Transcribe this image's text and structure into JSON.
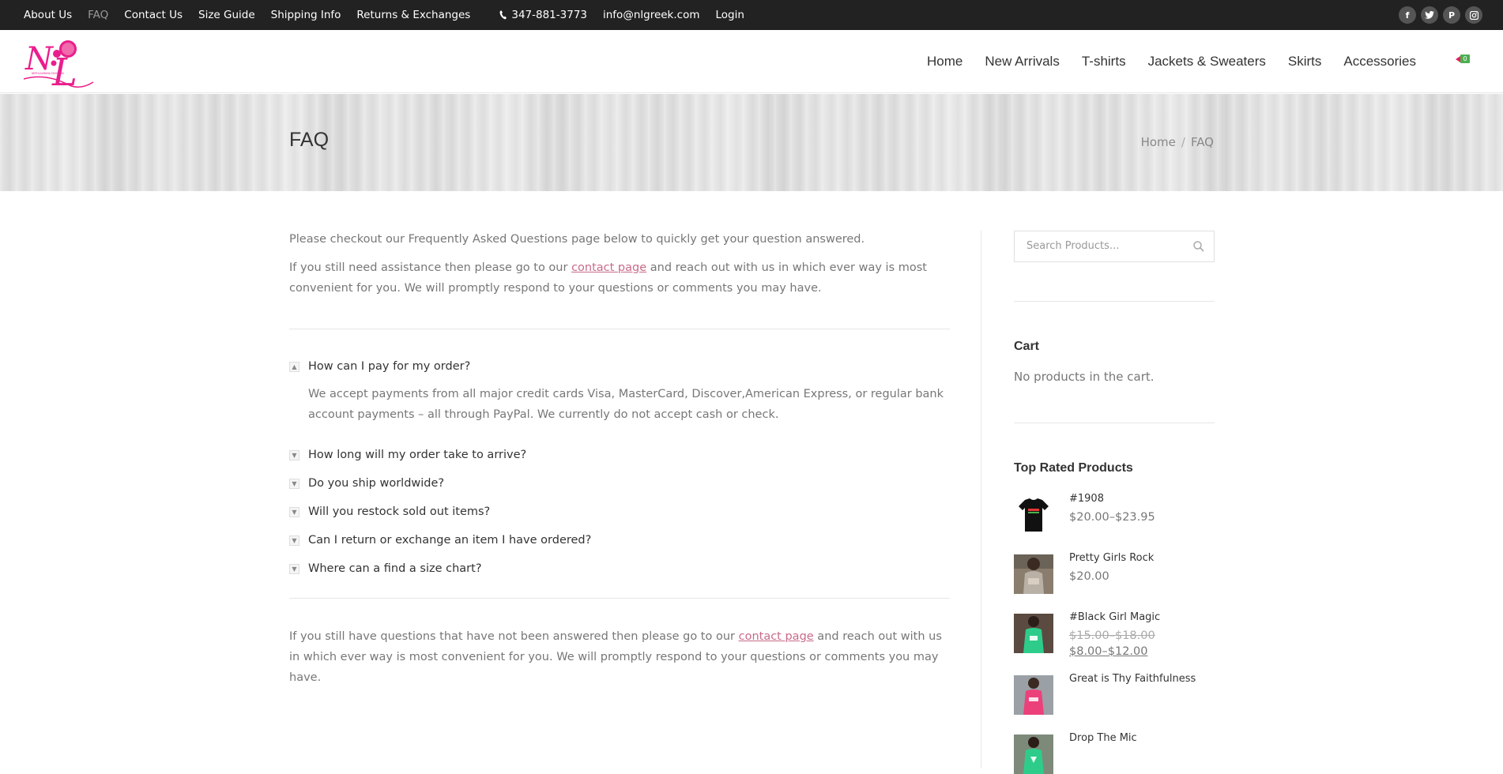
{
  "topbar": {
    "links": [
      {
        "label": "About Us",
        "active": false
      },
      {
        "label": "FAQ",
        "active": true
      },
      {
        "label": "Contact Us",
        "active": false
      },
      {
        "label": "Size Guide",
        "active": false
      },
      {
        "label": "Shipping Info",
        "active": false
      },
      {
        "label": "Returns & Exchanges",
        "active": false
      }
    ],
    "phone": "347-881-3773",
    "email": "info@nlgreek.com",
    "login": "Login",
    "social": [
      "facebook-icon",
      "twitter-icon",
      "pinterest-icon",
      "instagram-icon"
    ]
  },
  "header": {
    "logo_text": "NEPHLAURANA FASHIONS",
    "nav": [
      "Home",
      "New Arrivals",
      "T-shirts",
      "Jackets & Sweaters",
      "Skirts",
      "Accessories"
    ],
    "cart_count": "0"
  },
  "titlebar": {
    "title": "FAQ",
    "breadcrumb_home": "Home",
    "breadcrumb_sep": "/",
    "breadcrumb_current": "FAQ"
  },
  "content": {
    "intro_1": "Please checkout our Frequently Asked Questions page below to quickly get your question answered.",
    "intro_2_before": "If you still need assistance then please go to our ",
    "intro_2_link": "contact page",
    "intro_2_after": " and reach out with us in which ever way is most convenient for you. We will promptly respond to your questions or comments you may have.",
    "faq": [
      {
        "q": "How can I pay for my order?",
        "a": "We accept payments from all major credit cards Visa, MasterCard, Discover,American Express, or regular bank account payments – all through PayPal.  We currently do not accept cash or check.",
        "open": true
      },
      {
        "q": "How long will my order take to arrive?",
        "open": false
      },
      {
        "q": "Do you ship worldwide?",
        "open": false
      },
      {
        "q": "Will you restock sold out items?",
        "open": false
      },
      {
        "q": "Can I return or exchange an item I have ordered?",
        "open": false
      },
      {
        "q": "Where can a find a size chart?",
        "open": false
      }
    ],
    "outro_before": "If you still have questions that have not been answered then please go to our ",
    "outro_link": "contact page",
    "outro_after": " and reach out with us in which ever way is most convenient for you. We will promptly respond to your questions or comments you may have."
  },
  "sidebar": {
    "search_placeholder": "Search Products...",
    "cart_title": "Cart",
    "cart_empty": "No products in the cart.",
    "top_rated_title": "Top Rated Products",
    "products": [
      {
        "name": "#1908",
        "price": "$20.00–$23.95"
      },
      {
        "name": "Pretty Girls Rock",
        "price": "$20.00"
      },
      {
        "name": "#Black Girl Magic",
        "old_price": "$15.00–$18.00",
        "new_price": "$8.00–$12.00"
      },
      {
        "name": "Great is Thy Faithfulness"
      },
      {
        "name": "Drop The Mic"
      }
    ]
  },
  "colors": {
    "topbar_bg": "#222222",
    "link_pink": "#c96b87",
    "logo_pink": "#e91e8c",
    "cart_badge": "#4caf50"
  }
}
